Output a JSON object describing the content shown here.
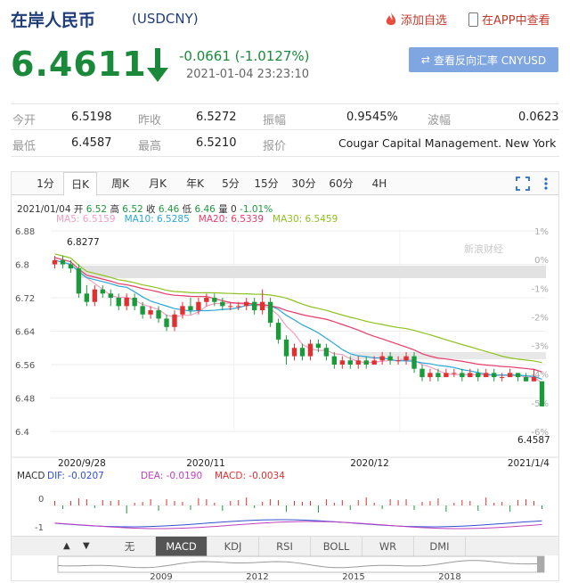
{
  "header": {
    "title": "在岸人民币",
    "code": "(USDCNY)",
    "add_fav": "添加自选",
    "open_app": "在APP中查看"
  },
  "quote": {
    "price": "6.4611",
    "change": "-0.0661 (-1.0127%)",
    "time": "2021-01-04 23:23:10",
    "reverse_btn": "查看反向汇率 CNYUSD"
  },
  "stats": {
    "row1": [
      {
        "label": "今开",
        "value": "6.5198"
      },
      {
        "label": "昨收",
        "value": "6.5272"
      },
      {
        "label": "振幅",
        "value": "0.9545%"
      },
      {
        "label": "波幅",
        "value": "0.0623"
      }
    ],
    "row2": [
      {
        "label": "最低",
        "value": "6.4587"
      },
      {
        "label": "最高",
        "value": "6.5210"
      },
      {
        "label": "报价",
        "value": "Cougar Capital Management. New York"
      }
    ]
  },
  "tabs": [
    "1分",
    "日K",
    "周K",
    "月K",
    "年K",
    "5分",
    "15分",
    "30分",
    "60分",
    "4H"
  ],
  "active_tab": "日K",
  "legend": {
    "date": "2021/01/04",
    "open_label": "开",
    "open": "6.52",
    "high_label": "高",
    "high": "6.52",
    "close_label": "收",
    "close": "6.46",
    "low_label": "低",
    "low": "6.46",
    "vol_label": "量",
    "vol": "0",
    "pct": "-1.01%",
    "ma5": "MA5: 6.5159",
    "ma10": "MA10: 6.5285",
    "ma20": "MA20: 6.5339",
    "ma30": "MA30: 6.5459"
  },
  "macd": {
    "label": "MACD",
    "dif": "DIF: -0.0207",
    "dea": "DEA: -0.0190",
    "macd": "MACD: -0.0034"
  },
  "indicator_tabs": [
    "无",
    "MACD",
    "KDJ",
    "RSI",
    "BOLL",
    "WR",
    "DMI"
  ],
  "active_indicator": "MACD",
  "nav_years": [
    "2009",
    "2012",
    "2015",
    "2018"
  ],
  "watermark": "新浪财经",
  "colors": {
    "up": "#e03030",
    "down": "#1a9a3a",
    "ma5": "#f19ec2",
    "ma10": "#2aa6d8",
    "ma20": "#e83c6a",
    "ma30": "#8dc21f"
  },
  "chart_data": {
    "type": "candlestick",
    "y_ticks": [
      "6.88",
      "6.8",
      "6.72",
      "6.64",
      "6.56",
      "6.48",
      "6.4"
    ],
    "ylim": [
      6.4,
      6.88
    ],
    "pct_ticks": [
      "1%",
      "0%",
      "-1%",
      "-2%",
      "-3%",
      "-4%",
      "-5%",
      "-6%"
    ],
    "x_labels": [
      "2020/9/28",
      "2020/11",
      "2020/12",
      "2021/1/4"
    ],
    "max_label": "6.8277",
    "min_label": "6.4587",
    "macd_ticks": [
      "0",
      "-1"
    ],
    "candles": [
      [
        6.8,
        6.81,
        6.79,
        6.82
      ],
      [
        6.81,
        6.8,
        6.79,
        6.82
      ],
      [
        6.8,
        6.79,
        6.78,
        6.81
      ],
      [
        6.79,
        6.73,
        6.72,
        6.8
      ],
      [
        6.73,
        6.71,
        6.7,
        6.75
      ],
      [
        6.71,
        6.74,
        6.7,
        6.75
      ],
      [
        6.74,
        6.73,
        6.72,
        6.75
      ],
      [
        6.73,
        6.72,
        6.7,
        6.74
      ],
      [
        6.72,
        6.7,
        6.69,
        6.73
      ],
      [
        6.7,
        6.72,
        6.69,
        6.73
      ],
      [
        6.72,
        6.7,
        6.69,
        6.73
      ],
      [
        6.7,
        6.68,
        6.67,
        6.71
      ],
      [
        6.68,
        6.69,
        6.67,
        6.7
      ],
      [
        6.69,
        6.67,
        6.66,
        6.7
      ],
      [
        6.67,
        6.65,
        6.64,
        6.68
      ],
      [
        6.65,
        6.68,
        6.64,
        6.69
      ],
      [
        6.68,
        6.7,
        6.67,
        6.71
      ],
      [
        6.7,
        6.69,
        6.68,
        6.72
      ],
      [
        6.69,
        6.71,
        6.68,
        6.72
      ],
      [
        6.71,
        6.72,
        6.7,
        6.73
      ],
      [
        6.72,
        6.71,
        6.7,
        6.73
      ],
      [
        6.71,
        6.7,
        6.69,
        6.72
      ],
      [
        6.7,
        6.7,
        6.69,
        6.71
      ],
      [
        6.7,
        6.7,
        6.69,
        6.71
      ],
      [
        6.7,
        6.71,
        6.69,
        6.72
      ],
      [
        6.71,
        6.69,
        6.68,
        6.72
      ],
      [
        6.69,
        6.71,
        6.68,
        6.74
      ],
      [
        6.71,
        6.66,
        6.65,
        6.72
      ],
      [
        6.66,
        6.62,
        6.61,
        6.67
      ],
      [
        6.62,
        6.58,
        6.56,
        6.63
      ],
      [
        6.58,
        6.6,
        6.57,
        6.61
      ],
      [
        6.6,
        6.58,
        6.57,
        6.61
      ],
      [
        6.58,
        6.61,
        6.57,
        6.62
      ],
      [
        6.61,
        6.6,
        6.59,
        6.62
      ],
      [
        6.6,
        6.58,
        6.57,
        6.61
      ],
      [
        6.58,
        6.56,
        6.55,
        6.59
      ],
      [
        6.56,
        6.57,
        6.55,
        6.58
      ],
      [
        6.57,
        6.56,
        6.55,
        6.58
      ],
      [
        6.56,
        6.57,
        6.55,
        6.58
      ],
      [
        6.57,
        6.56,
        6.55,
        6.58
      ],
      [
        6.56,
        6.57,
        6.56,
        6.58
      ],
      [
        6.57,
        6.58,
        6.56,
        6.59
      ],
      [
        6.58,
        6.57,
        6.56,
        6.59
      ],
      [
        6.57,
        6.57,
        6.56,
        6.58
      ],
      [
        6.57,
        6.58,
        6.56,
        6.59
      ],
      [
        6.58,
        6.55,
        6.54,
        6.59
      ],
      [
        6.55,
        6.53,
        6.52,
        6.56
      ],
      [
        6.53,
        6.54,
        6.52,
        6.55
      ],
      [
        6.54,
        6.53,
        6.52,
        6.55
      ],
      [
        6.53,
        6.54,
        6.53,
        6.55
      ],
      [
        6.54,
        6.54,
        6.53,
        6.55
      ],
      [
        6.54,
        6.53,
        6.52,
        6.55
      ],
      [
        6.53,
        6.54,
        6.53,
        6.55
      ],
      [
        6.54,
        6.53,
        6.52,
        6.55
      ],
      [
        6.53,
        6.54,
        6.53,
        6.55
      ],
      [
        6.54,
        6.53,
        6.52,
        6.55
      ],
      [
        6.53,
        6.53,
        6.52,
        6.54
      ],
      [
        6.53,
        6.54,
        6.53,
        6.55
      ],
      [
        6.54,
        6.53,
        6.52,
        6.54
      ],
      [
        6.53,
        6.52,
        6.52,
        6.54
      ],
      [
        6.52,
        6.53,
        6.52,
        6.55
      ],
      [
        6.52,
        6.46,
        6.46,
        6.52
      ]
    ]
  }
}
